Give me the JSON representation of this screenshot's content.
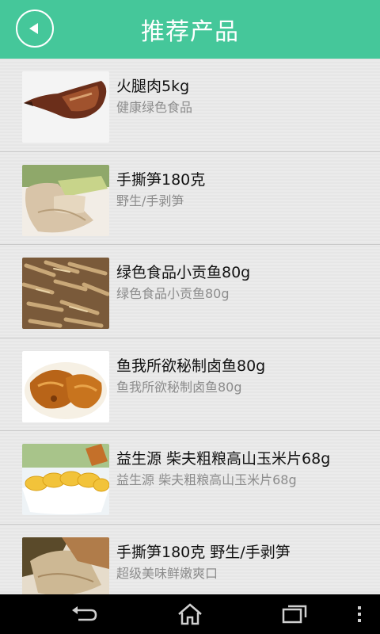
{
  "header": {
    "title": "推荐产品"
  },
  "icons": {
    "back": "back-arrow-icon",
    "nav_back": "nav-back-icon",
    "nav_home": "home-icon",
    "nav_recent": "recent-apps-icon",
    "nav_menu": "overflow-menu-icon"
  },
  "colors": {
    "header_bg": "#45c79a",
    "title": "#ffffff",
    "name_text": "#111111",
    "desc_text": "#8c8c8c",
    "nav_bar": "#000000"
  },
  "products": [
    {
      "name": "火腿肉5kg",
      "desc": "健康绿色食品",
      "image": "ham-image"
    },
    {
      "name": "手撕笋180克",
      "desc": "野生/手剥笋",
      "image": "bamboo-shoot-image"
    },
    {
      "name": "绿色食品小贡鱼80g",
      "desc": "绿色食品小贡鱼80g",
      "image": "small-fish-image"
    },
    {
      "name": "鱼我所欲秘制卤鱼80g",
      "desc": "鱼我所欲秘制卤鱼80g",
      "image": "braised-fish-image"
    },
    {
      "name": "益生源 柴夫粗粮高山玉米片68g",
      "desc": "益生源 柴夫粗粮高山玉米片68g",
      "image": "corn-chips-image"
    },
    {
      "name": "手撕笋180克 野生/手剥笋",
      "desc": "超级美味鲜嫩爽口",
      "image": "bamboo-shoot-image-2"
    }
  ]
}
